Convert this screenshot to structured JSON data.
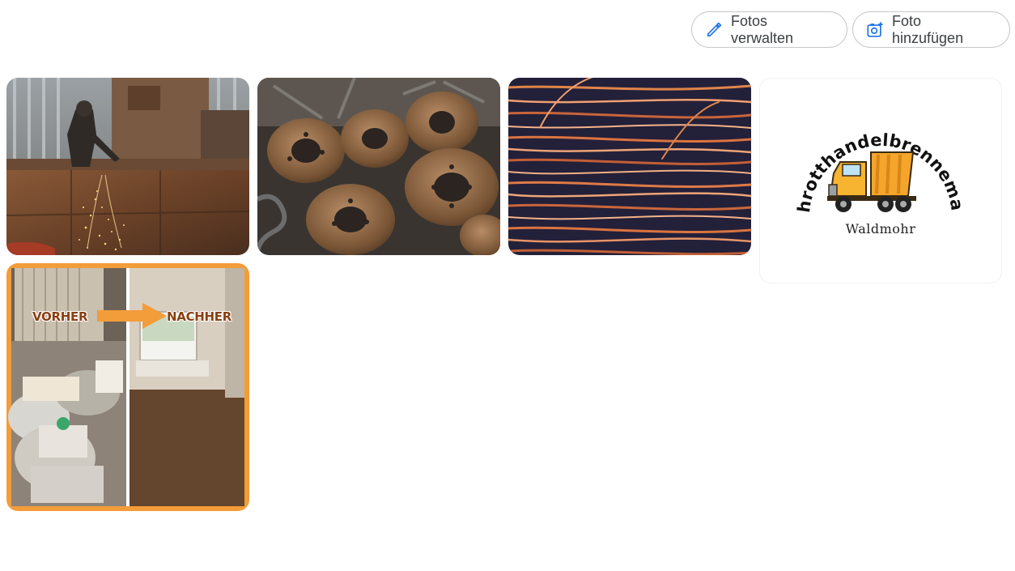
{
  "toolbar": {
    "manage_label": "Fotos verwalten",
    "manage_icon": "pencil-icon",
    "add_label": "Foto hinzufügen",
    "add_icon": "add-photo-icon",
    "icon_color": "#1a73e8"
  },
  "photos": [
    {
      "id": "welder",
      "description_icon": "photo-welding"
    },
    {
      "id": "brake-discs",
      "description_icon": "photo-brake-discs"
    },
    {
      "id": "copper-wire",
      "description_icon": "photo-copper-wire"
    },
    {
      "id": "logo",
      "logo_arc_text": "Schrotthandelbrennemann",
      "logo_subtitle": "Waldmohr"
    },
    {
      "id": "before-after",
      "label_before": "VORHER",
      "label_after": "NACHHER",
      "accent": "#f39c3a"
    }
  ]
}
